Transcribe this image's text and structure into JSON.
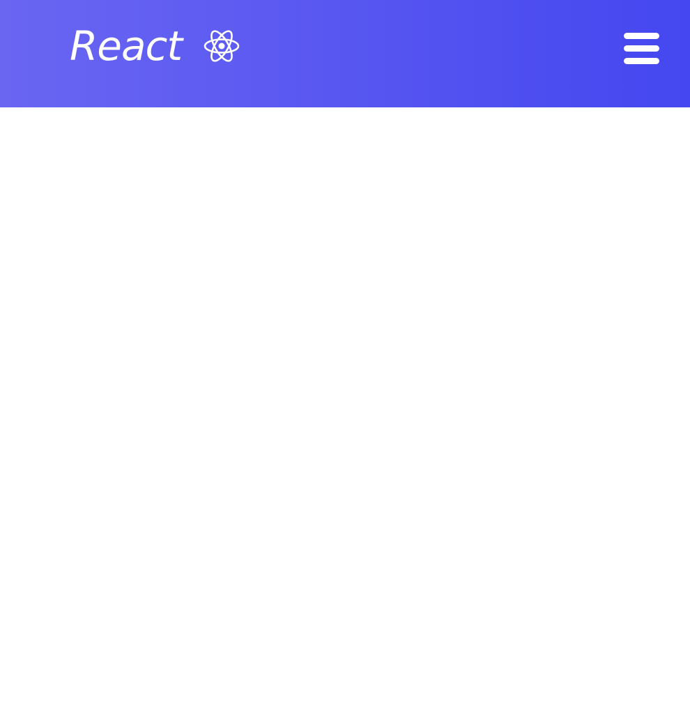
{
  "header": {
    "brand_title": "React",
    "brand_icon": "react-atom-icon",
    "menu_icon": "hamburger-menu-icon",
    "gradient_start": "#6a66f2",
    "gradient_end": "#4547f0"
  },
  "main": {}
}
